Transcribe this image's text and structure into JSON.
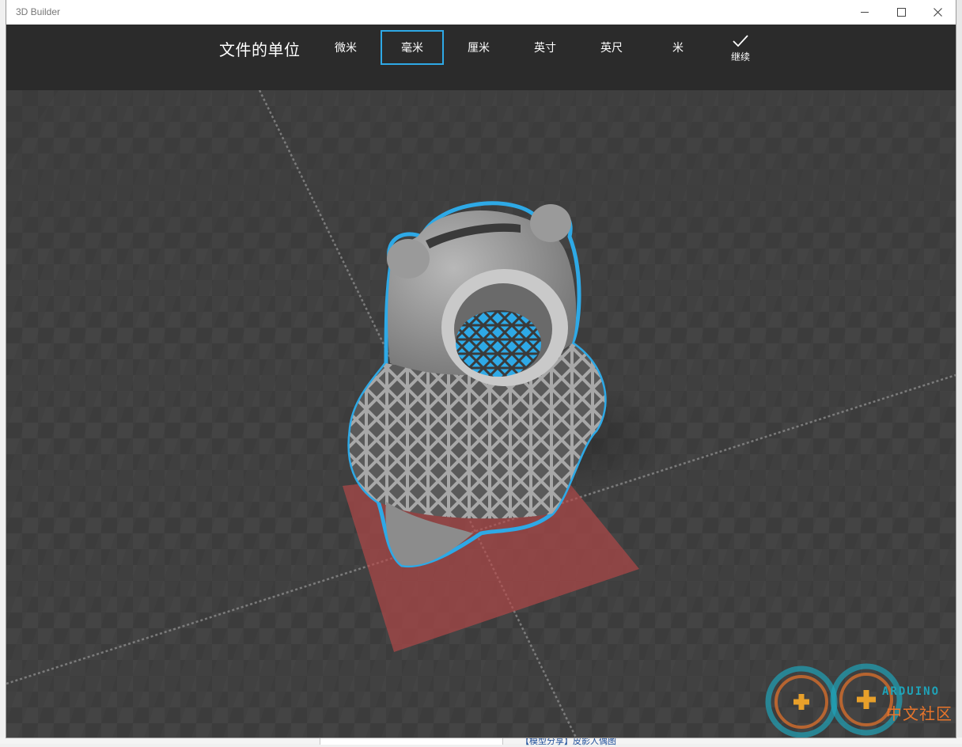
{
  "window": {
    "title": "3D Builder"
  },
  "toolbar": {
    "units_title": "文件的单位",
    "units": [
      {
        "label": "微米",
        "selected": false
      },
      {
        "label": "毫米",
        "selected": true
      },
      {
        "label": "厘米",
        "selected": false
      },
      {
        "label": "英寸",
        "selected": false
      },
      {
        "label": "英尺",
        "selected": false
      },
      {
        "label": "米",
        "selected": false
      }
    ],
    "continue_label": "继续",
    "continue_icon": "checkmark-icon"
  },
  "background": {
    "link_text": "【模型分享】皮影人偶图"
  },
  "watermark": {
    "sub_text": "ARDUINO",
    "main_text": "中文社区"
  },
  "colors": {
    "accent": "#2ea9e6",
    "toolbar_bg": "#2b2b2b",
    "viewport_bg": "#3a3a3a",
    "build_plate": "#b94848"
  }
}
